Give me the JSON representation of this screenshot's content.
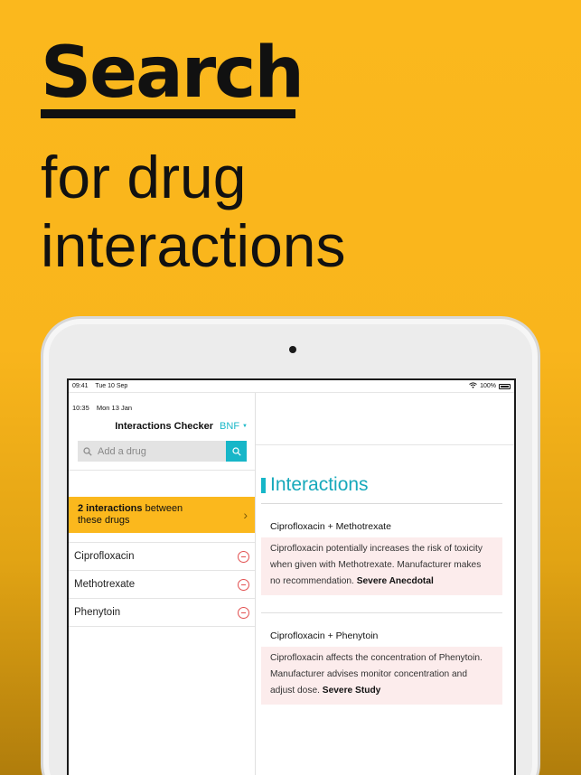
{
  "headline": "Search",
  "subhead": "for drug\ninteractions",
  "device": {
    "status_time": "09:41",
    "status_date": "Tue 10 Sep",
    "battery": "100%"
  },
  "left_pane": {
    "inner_time": "10:35",
    "inner_date": "Mon 13 Jan",
    "title": "Interactions Checker",
    "source": "BNF",
    "search_placeholder": "Add a drug",
    "banner_bold": "2 interactions",
    "banner_rest": " between these drugs",
    "drugs": [
      "Ciprofloxacin",
      "Methotrexate",
      "Phenytoin"
    ]
  },
  "right_pane": {
    "title": "Interactions",
    "interactions": [
      {
        "pair": "Ciprofloxacin + Methotrexate",
        "text": "Ciprofloxacin potentially increases the risk of toxicity when given with Methotrexate. Manufacturer makes no recommendation. ",
        "rating": "Severe Anecdotal"
      },
      {
        "pair": "Ciprofloxacin + Phenytoin",
        "text": "Ciprofloxacin affects the concentration of Phenytoin. Manufacturer advises monitor concentration and adjust dose. ",
        "rating": "Severe Study"
      }
    ]
  },
  "colors": {
    "background": "#fbb81d",
    "accent": "#17b6c8",
    "remove": "#e25151",
    "interaction_bg": "#fcecec"
  }
}
